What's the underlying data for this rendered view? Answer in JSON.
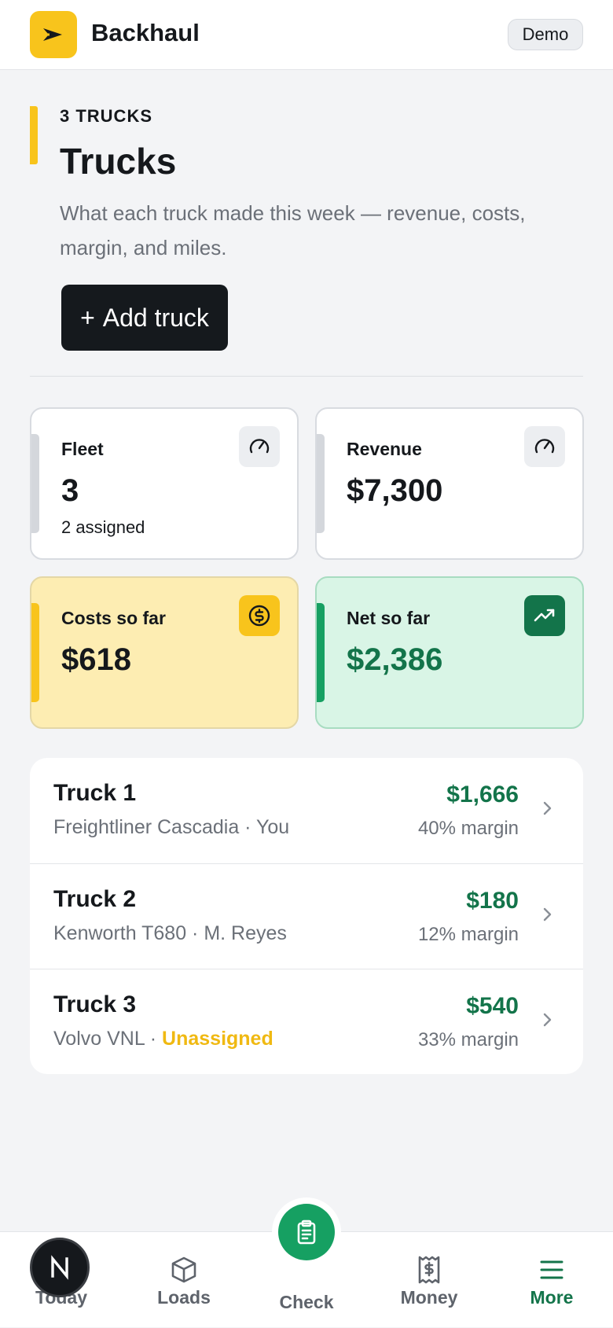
{
  "app": {
    "title": "Backhaul",
    "mode_badge": "Demo"
  },
  "header": {
    "eyebrow": "3 TRUCKS",
    "title": "Trucks",
    "description": "What each truck made this week — revenue, costs, margin, and miles.",
    "add_button_icon": "+",
    "add_button_label": "Add truck"
  },
  "stats": {
    "fleet": {
      "label": "Fleet",
      "value": "3",
      "sub": "2 assigned",
      "icon": "gauge-icon"
    },
    "revenue": {
      "label": "Revenue",
      "value": "$7,300",
      "icon": "gauge-icon"
    },
    "costs": {
      "label": "Costs so far",
      "value": "$618",
      "icon": "dollar-circle-icon"
    },
    "net": {
      "label": "Net so far",
      "value": "$2,386",
      "icon": "trending-up-icon"
    }
  },
  "trucks": [
    {
      "name": "Truck 1",
      "model": "Freightliner Cascadia",
      "separator": " · ",
      "driver": "You",
      "net": "$1,666",
      "margin": "40% margin"
    },
    {
      "name": "Truck 2",
      "model": "Kenworth T680",
      "separator": " · ",
      "driver": "M. Reyes",
      "net": "$180",
      "margin": "12% margin"
    },
    {
      "name": "Truck 3",
      "model": "Volvo VNL",
      "separator": " · ",
      "driver": "Unassigned",
      "net": "$540",
      "margin": "33% margin"
    }
  ],
  "nav": {
    "today": "Today",
    "loads": "Loads",
    "check": "Check",
    "money": "Money",
    "more": "More",
    "active": "more"
  },
  "dev_badge": "N",
  "colors": {
    "brand_yellow": "#f8c41c",
    "positive_green": "#13744a",
    "warning": "#f0b912",
    "dark_button": "#15191d"
  }
}
